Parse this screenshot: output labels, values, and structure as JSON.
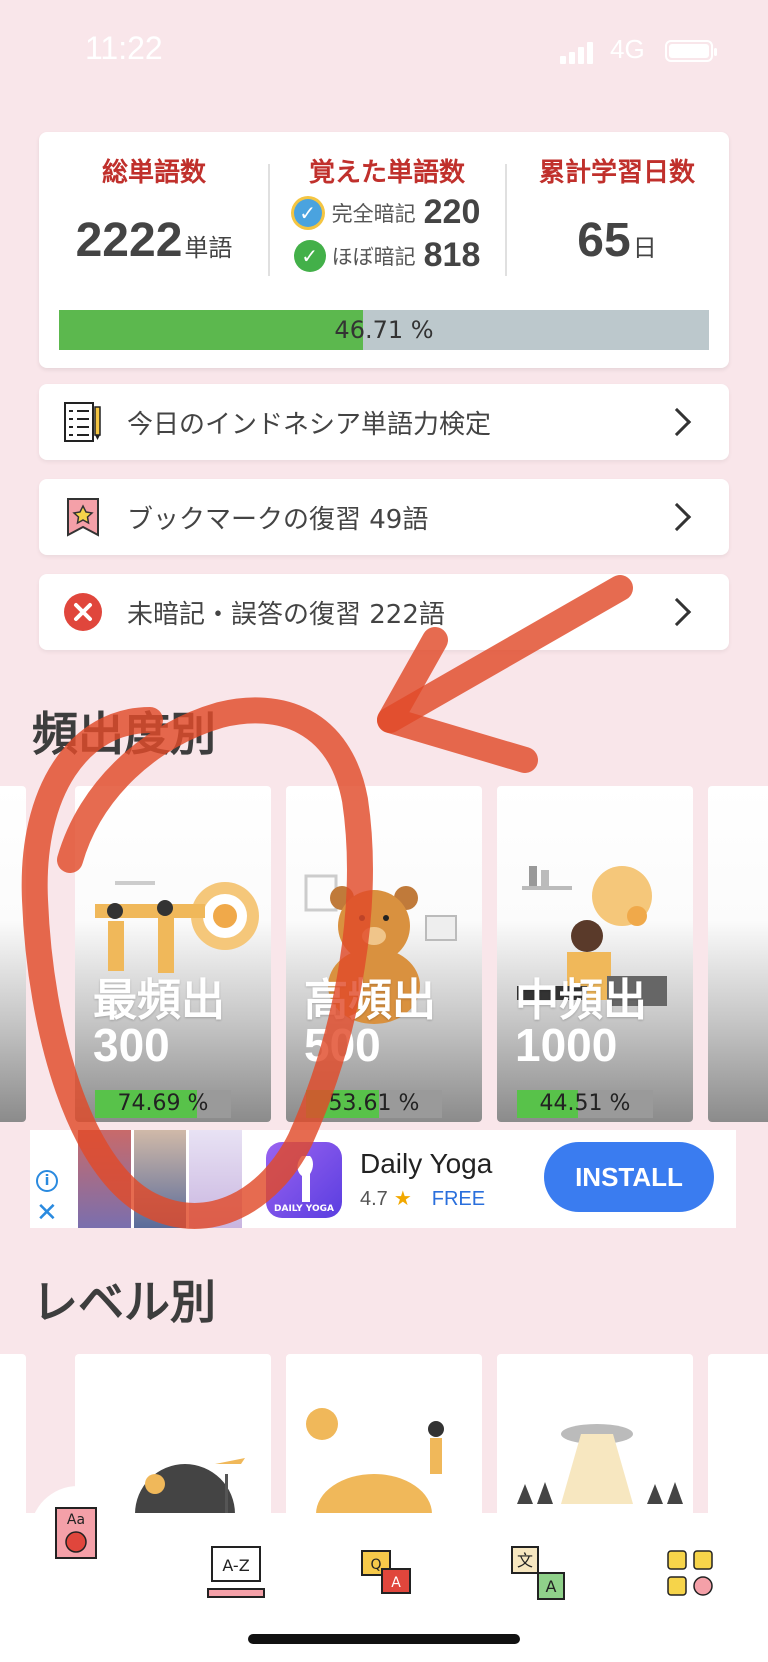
{
  "status": {
    "time": "11:22",
    "network": "4G"
  },
  "stats": {
    "total_words_label": "総単語数",
    "total_words": "2222",
    "total_words_unit": "単語",
    "learned_label": "覚えた単語数",
    "fully_label": "完全暗記",
    "fully_count": "220",
    "almost_label": "ほぼ暗記",
    "almost_count": "818",
    "days_label": "累計学習日数",
    "days": "65",
    "days_unit": "日",
    "progress_text": "46.71 %",
    "progress_fraction": 0.4671
  },
  "menu": [
    {
      "label": "今日のインドネシア単語力検定",
      "icon": "test-checklist-icon"
    },
    {
      "label": "ブックマークの復習 49語",
      "icon": "bookmark-star-icon"
    },
    {
      "label": "未暗記・誤答の復習 222語",
      "icon": "error-x-icon"
    }
  ],
  "section_frequency": "頻出度別",
  "frequency_cards": [
    {
      "name": "最頻出",
      "count": "300",
      "percent_text": "74.69 %",
      "fraction": 0.7469
    },
    {
      "name": "高頻出",
      "count": "500",
      "percent_text": "53.61 %",
      "fraction": 0.5361
    },
    {
      "name": "中頻出",
      "count": "1000",
      "percent_text": "44.51 %",
      "fraction": 0.4451
    }
  ],
  "ad": {
    "app_name": "Daily Yoga",
    "rating": "4.7",
    "price": "FREE",
    "install": "INSTALL",
    "icon_text": "DAILY YOGA"
  },
  "section_level": "レベル別",
  "colors": {
    "background": "#f9e6ea",
    "accent_red": "#c0302c",
    "progress_green": "#5cb84e",
    "install_blue": "#3a7cf0",
    "annotation": "#e04a2a"
  }
}
